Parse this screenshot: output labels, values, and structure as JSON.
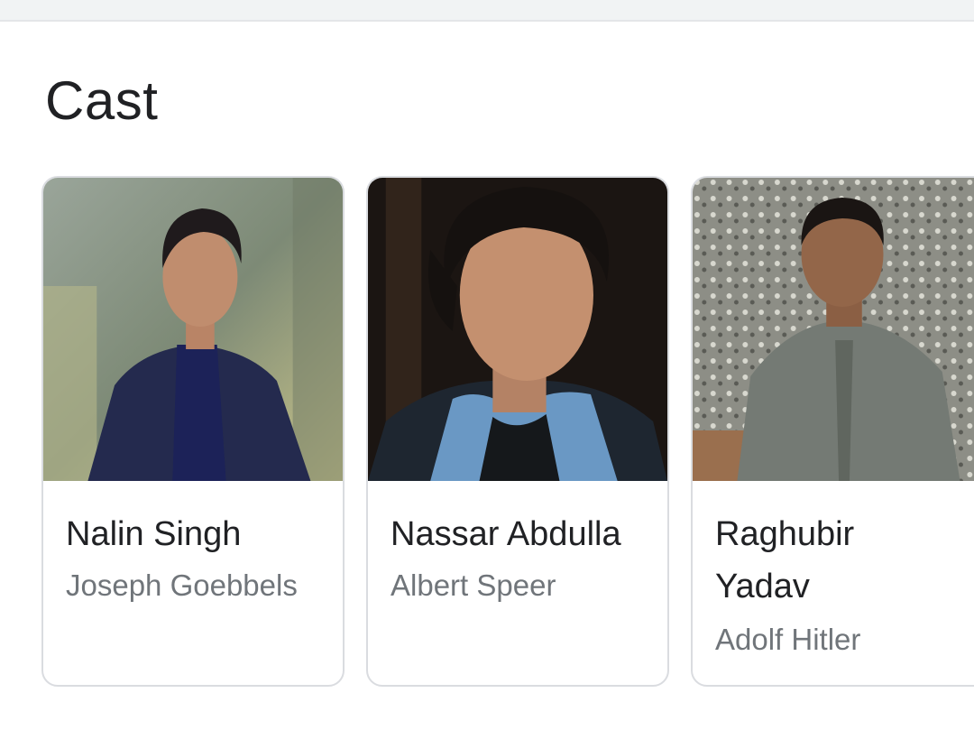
{
  "section": {
    "title": "Cast"
  },
  "cast": [
    {
      "actor": "Nalin Singh",
      "role": "Joseph Goebbels"
    },
    {
      "actor": "Nassar Abdulla",
      "role": "Albert Speer"
    },
    {
      "actor": "Raghubir Yadav",
      "role": "Adolf Hitler"
    }
  ],
  "colors": {
    "title_text": "#202124",
    "secondary_text": "#70757a",
    "card_border": "#dadce0"
  }
}
